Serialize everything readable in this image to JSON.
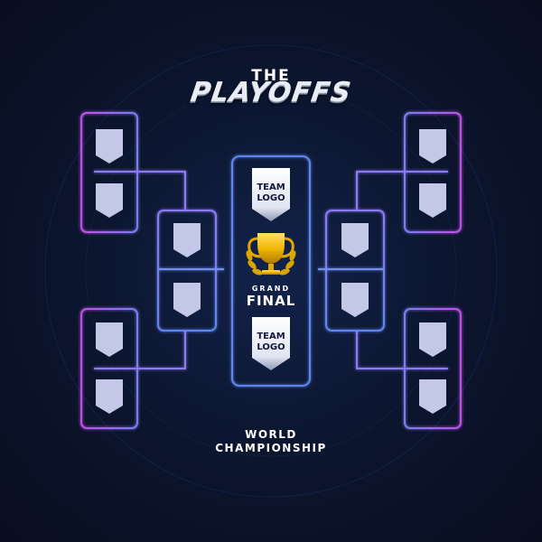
{
  "header": {
    "the": "THE",
    "title": "PLAYOFFS"
  },
  "final": {
    "team_top": [
      "TEAM",
      "LOGO"
    ],
    "team_bottom": [
      "TEAM",
      "LOGO"
    ],
    "grand": "GRAND",
    "final": "FINAL",
    "trophy_icon": "trophy-icon"
  },
  "footer": {
    "line1": "WORLD",
    "line2": "CHAMPIONSHIP"
  },
  "colors": {
    "background": "#0c1630",
    "outer_bracket": "#a855f7",
    "inner_bracket": "#6f8ff0",
    "slot_fill": "#c3c8e6",
    "trophy": "#f2b705"
  }
}
